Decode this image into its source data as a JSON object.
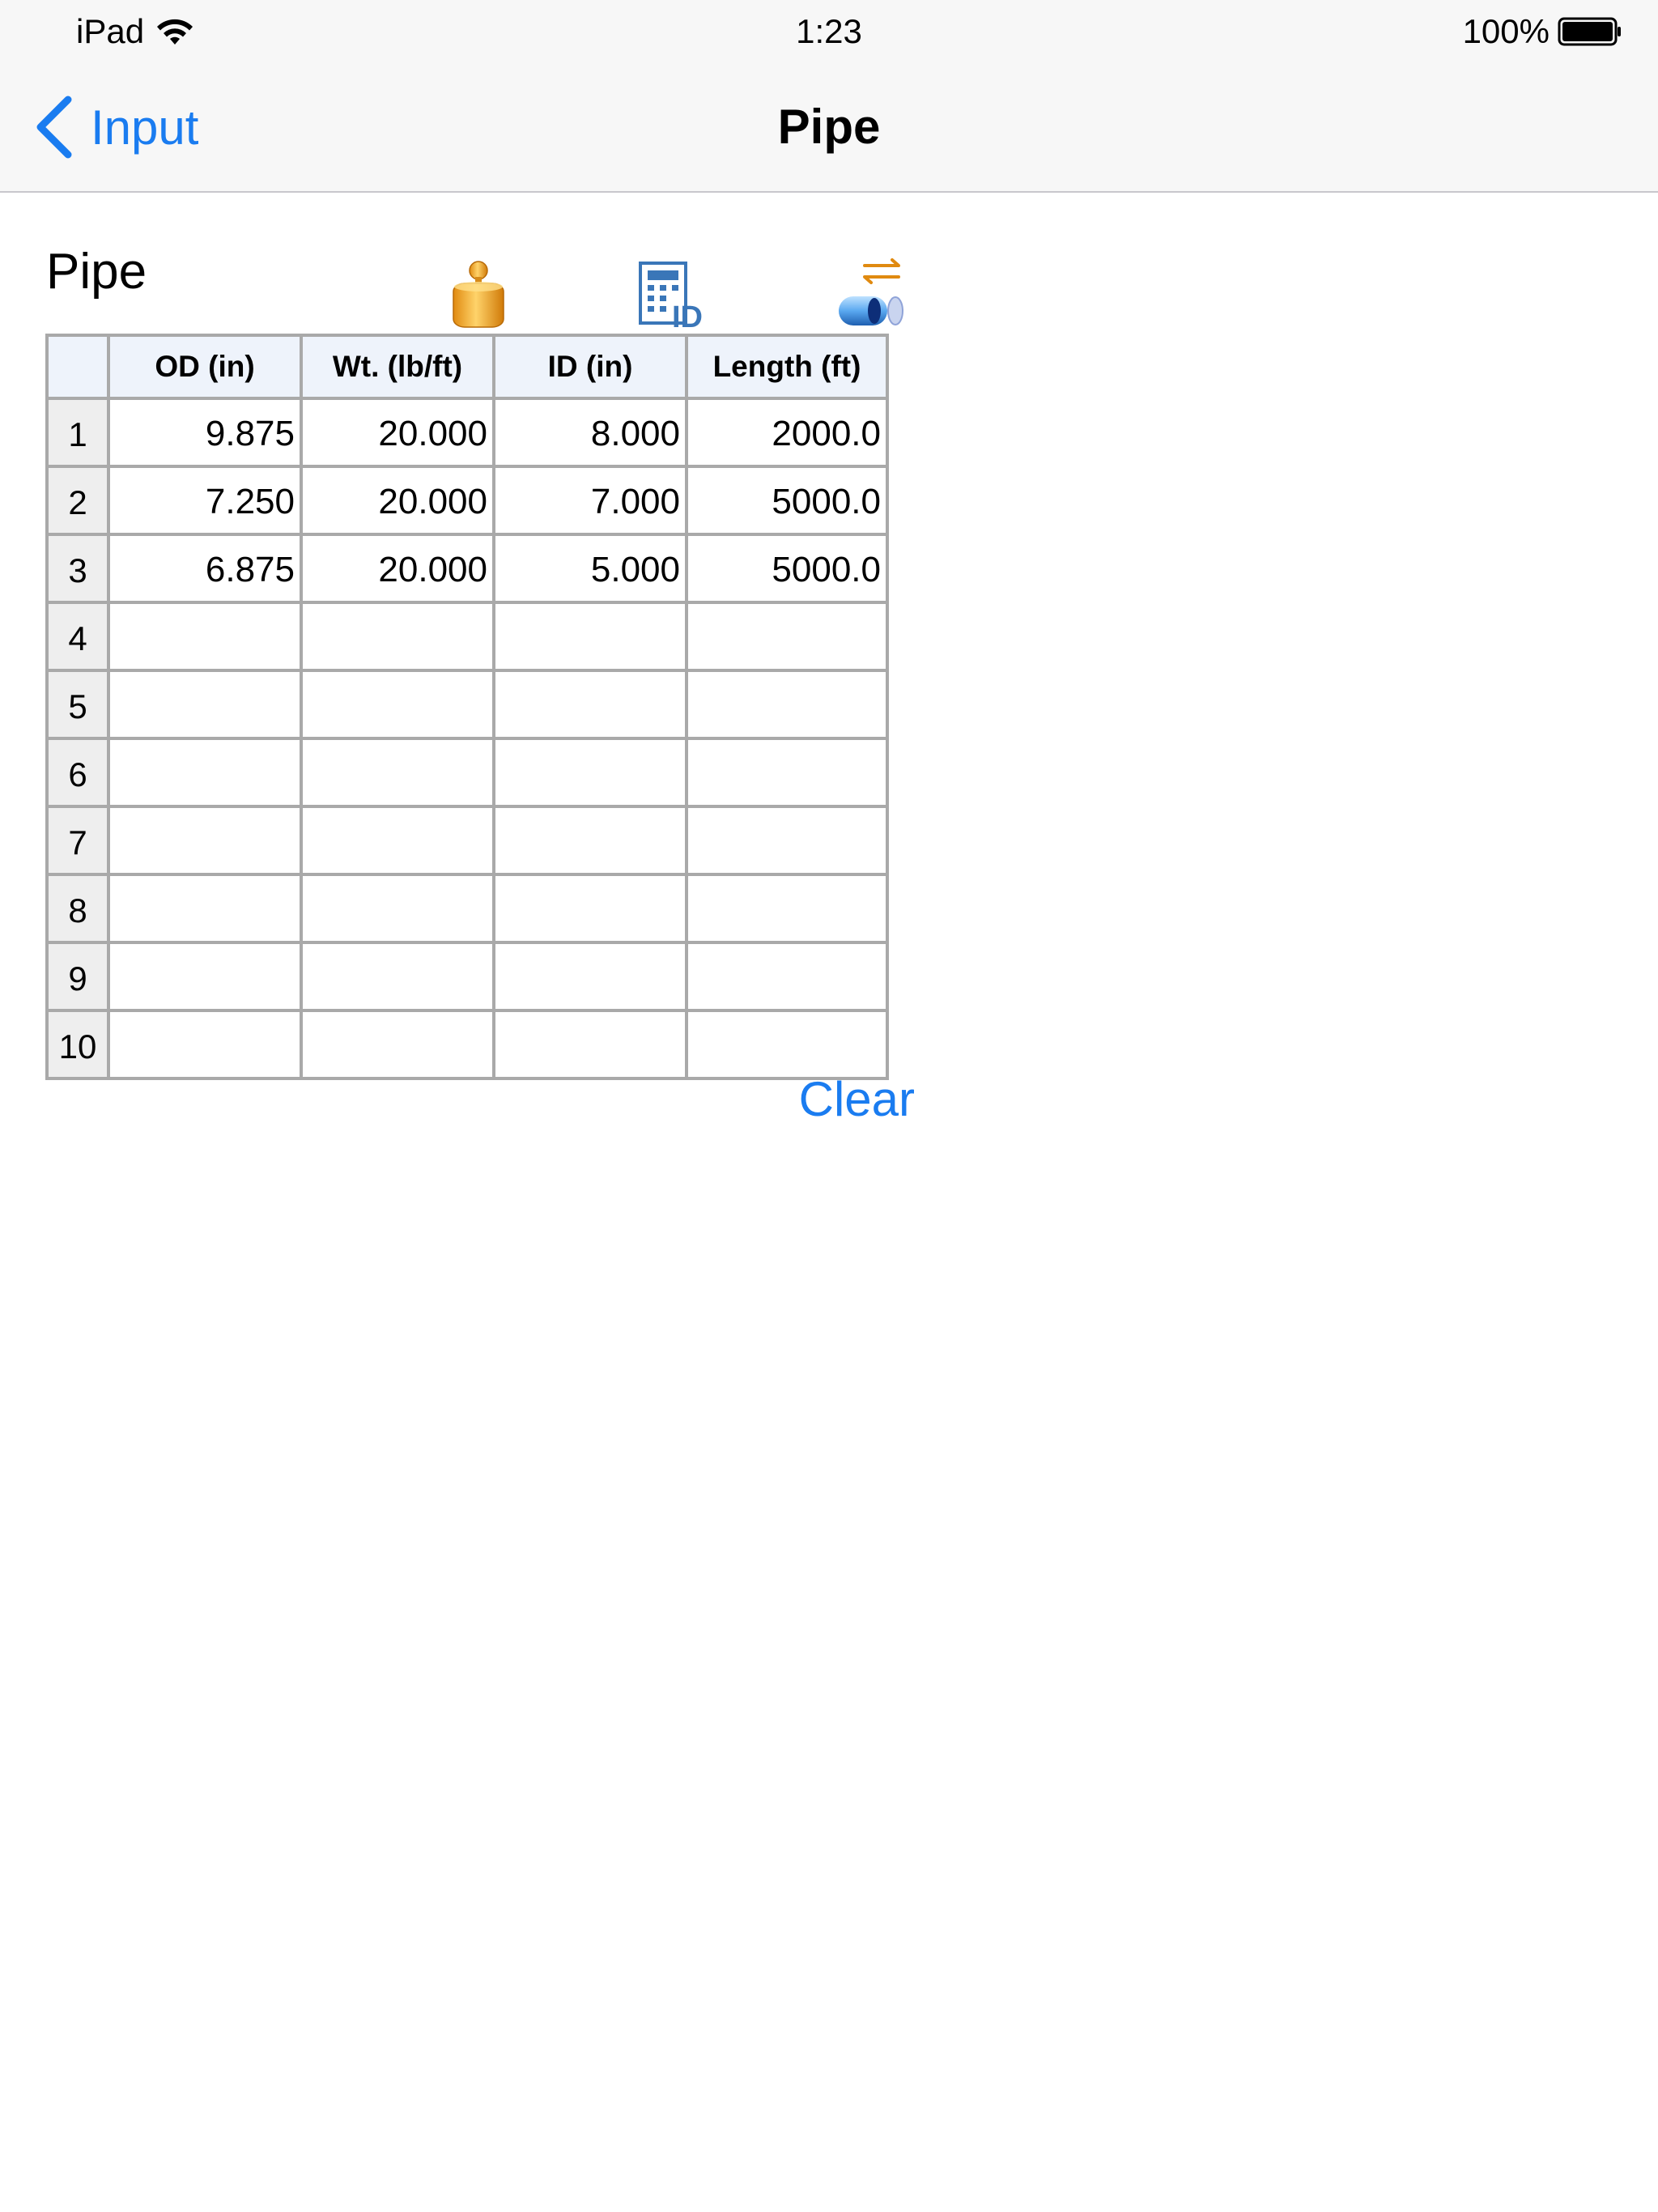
{
  "status_bar": {
    "device": "iPad",
    "time": "1:23",
    "battery": "100%"
  },
  "nav": {
    "back_label": "Input",
    "title": "Pipe"
  },
  "section": {
    "title": "Pipe"
  },
  "toolbar_icons": [
    "weight-icon",
    "calculate-id-icon",
    "convert-pipe-icon"
  ],
  "table": {
    "headers": [
      "",
      "OD (in)",
      "Wt. (lb/ft)",
      "ID (in)",
      "Length (ft)"
    ],
    "rows": [
      {
        "num": "1",
        "od": "9.875",
        "wt": "20.000",
        "id": "8.000",
        "length": "2000.0"
      },
      {
        "num": "2",
        "od": "7.250",
        "wt": "20.000",
        "id": "7.000",
        "length": "5000.0"
      },
      {
        "num": "3",
        "od": "6.875",
        "wt": "20.000",
        "id": "5.000",
        "length": "5000.0"
      },
      {
        "num": "4",
        "od": "",
        "wt": "",
        "id": "",
        "length": ""
      },
      {
        "num": "5",
        "od": "",
        "wt": "",
        "id": "",
        "length": ""
      },
      {
        "num": "6",
        "od": "",
        "wt": "",
        "id": "",
        "length": ""
      },
      {
        "num": "7",
        "od": "",
        "wt": "",
        "id": "",
        "length": ""
      },
      {
        "num": "8",
        "od": "",
        "wt": "",
        "id": "",
        "length": ""
      },
      {
        "num": "9",
        "od": "",
        "wt": "",
        "id": "",
        "length": ""
      },
      {
        "num": "10",
        "od": "",
        "wt": "",
        "id": "",
        "length": ""
      }
    ]
  },
  "actions": {
    "clear_label": "Clear"
  },
  "colors": {
    "accent": "#1a7cf0",
    "header_bg": "#eef3fb",
    "rownum_bg": "#eeeeee",
    "grid_line": "#a9a9a9"
  }
}
